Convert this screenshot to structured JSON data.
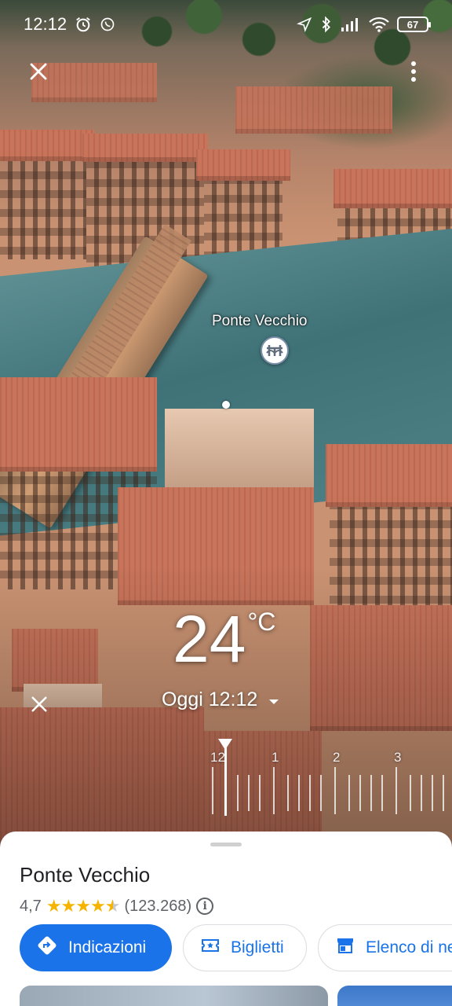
{
  "status_bar": {
    "time": "12:12",
    "battery": "67"
  },
  "map": {
    "place_label": "Ponte Vecchio",
    "place_icon": "bridge-icon"
  },
  "weather": {
    "temperature": "24",
    "unit": "°C",
    "time_label": "Oggi 12:12"
  },
  "timeline": {
    "labels": [
      "12",
      "1",
      "2",
      "3"
    ]
  },
  "place": {
    "name": "Ponte Vecchio",
    "rating": "4,7",
    "stars": 4.7,
    "reviews": "(123.268)"
  },
  "actions": {
    "directions": "Indicazioni",
    "tickets": "Biglietti",
    "list": "Elenco di ne"
  },
  "colors": {
    "accent": "#1a73e8",
    "star": "#f4b400"
  }
}
